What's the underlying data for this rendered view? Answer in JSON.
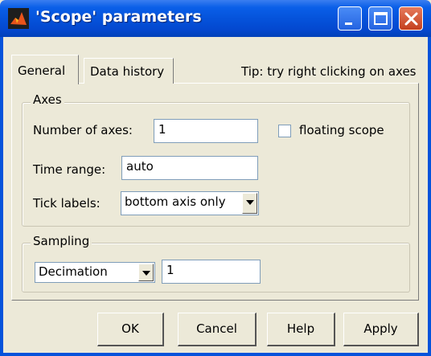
{
  "window": {
    "title": "'Scope' parameters",
    "icon": "matlab-icon",
    "controls": [
      "minimize-icon",
      "maximize-icon",
      "close-icon"
    ]
  },
  "tabs": [
    {
      "label": "General",
      "selected": true
    },
    {
      "label": "Data history",
      "selected": false
    }
  ],
  "tip": "Tip: try right clicking on axes",
  "axes_group": {
    "legend": "Axes",
    "num_axes_label": "Number of axes:",
    "num_axes_value": "1",
    "floating_scope_label": "floating scope",
    "floating_scope_checked": false,
    "time_range_label": "Time range:",
    "time_range_value": "auto",
    "tick_labels_label": "Tick labels:",
    "tick_labels_value": "bottom axis only"
  },
  "sampling_group": {
    "legend": "Sampling",
    "mode_value": "Decimation",
    "factor_value": "1"
  },
  "buttons": {
    "ok": "OK",
    "cancel": "Cancel",
    "help": "Help",
    "apply": "Apply"
  }
}
